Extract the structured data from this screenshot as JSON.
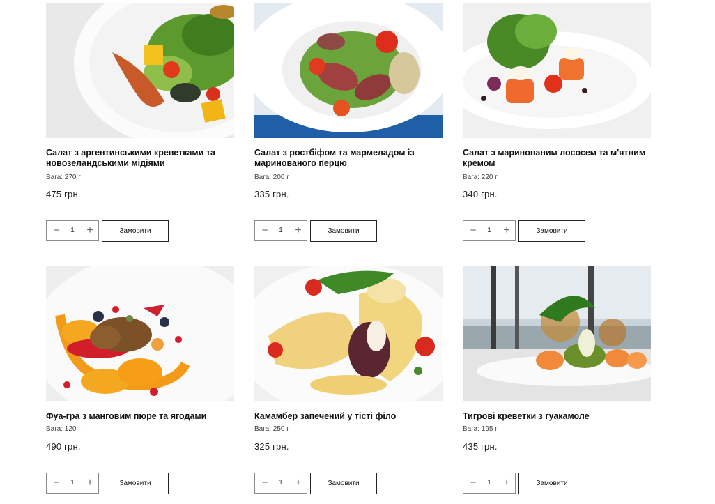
{
  "products": [
    {
      "image": "salad-shrimp-mussels-photo",
      "title": "Салат з аргентинськими креветками та новозеландськими мідіями",
      "weight": "Вага: 270 г",
      "price": "475 грн.",
      "qty": "1",
      "order_label": "Замовити"
    },
    {
      "image": "salad-roastbeef-photo",
      "title": "Салат з ростбіфом та мармеладом із маринованого перцю",
      "weight": "Вага: 200 г",
      "price": "335 грн.",
      "qty": "1",
      "order_label": "Замовити"
    },
    {
      "image": "salad-salmon-photo",
      "title": "Салат з маринованим лососем та м'ятним кремом",
      "weight": "Вага: 220 г",
      "price": "340 грн.",
      "qty": "1",
      "order_label": "Замовити"
    },
    {
      "image": "foie-gras-photo",
      "title": "Фуа-гра з манговим пюре та ягодами",
      "weight": "Вага: 120 г",
      "price": "490 грн.",
      "qty": "1",
      "order_label": "Замовити"
    },
    {
      "image": "camembert-filo-photo",
      "title": "Камамбер запечений у тісті філо",
      "weight": "Вага: 250 г",
      "price": "325 грн.",
      "qty": "1",
      "order_label": "Замовити"
    },
    {
      "image": "tiger-prawns-guacamole-photo",
      "title": "Тигрові креветки з гуакамоле",
      "weight": "Вага: 195 г",
      "price": "435 грн.",
      "qty": "1",
      "order_label": "Замовити"
    }
  ],
  "stepper": {
    "minus": "−",
    "plus": "+"
  }
}
